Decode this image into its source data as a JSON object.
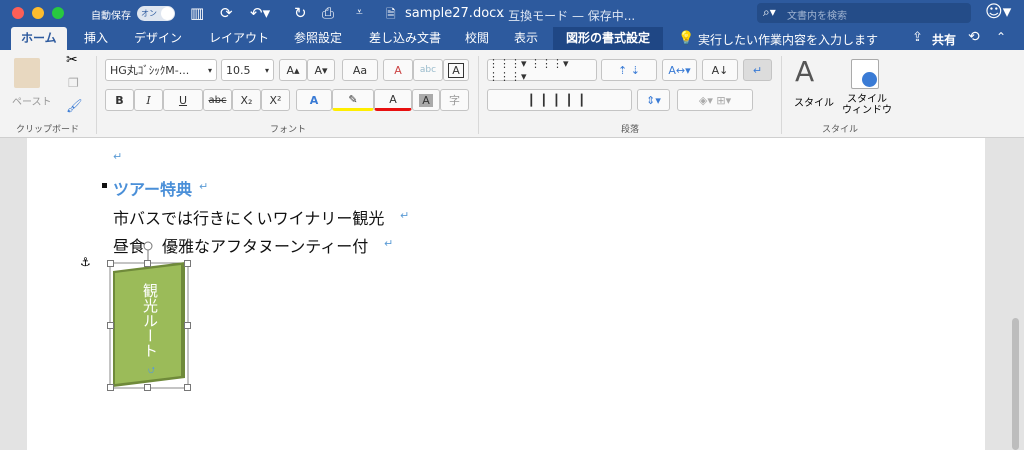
{
  "titlebar": {
    "autosave_label": "自動保存",
    "autosave_toggle": "オン",
    "doc_title": "sample27.docx",
    "mode": "- 互換モード — 保存中...",
    "search_placeholder": "文書内を検索"
  },
  "tabs": [
    {
      "label": "ホーム"
    },
    {
      "label": "挿入"
    },
    {
      "label": "デザイン"
    },
    {
      "label": "レイアウト"
    },
    {
      "label": "参照設定"
    },
    {
      "label": "差し込み文書"
    },
    {
      "label": "校閲"
    },
    {
      "label": "表示"
    },
    {
      "label": "図形の書式設定"
    }
  ],
  "tellme": "実行したい作業内容を入力します",
  "share": "共有",
  "ribbon": {
    "paste": "ペースト",
    "clipboard_group": "クリップボード",
    "font_name": "HG丸ｺﾞｼｯｸM-...",
    "font_size": "10.5",
    "font_group": "フォント",
    "paragraph_group": "段落",
    "style_label": "スタイル",
    "style_window": "スタイル\nウィンドウ",
    "styles_group": "スタイル",
    "buttons": {
      "bold": "B",
      "italic": "I",
      "underline": "U",
      "strike": "abc",
      "sub": "X₂",
      "sup": "X²",
      "grow": "A▴",
      "shrink": "A▾",
      "case": "Aa",
      "clear": "A",
      "phonetic": "abc",
      "border": "A",
      "effect": "A",
      "highlight": "✎",
      "color": "A",
      "shade": "A",
      "enclose": "字"
    }
  },
  "colors": {
    "accent": "#2d5a9e",
    "heading": "#4a8fd8",
    "shape_fill": "#9bbb59",
    "font_color": "#e81010",
    "highlight": "#ffee00"
  },
  "document": {
    "heading": "ツアー特典",
    "line1": "市バスでは行きにくいワイナリー観光",
    "line2": "昼食",
    "line2b": "優雅なアフタヌーンティー付",
    "shape_text": "観光ルート",
    "para_mark": "↵"
  }
}
